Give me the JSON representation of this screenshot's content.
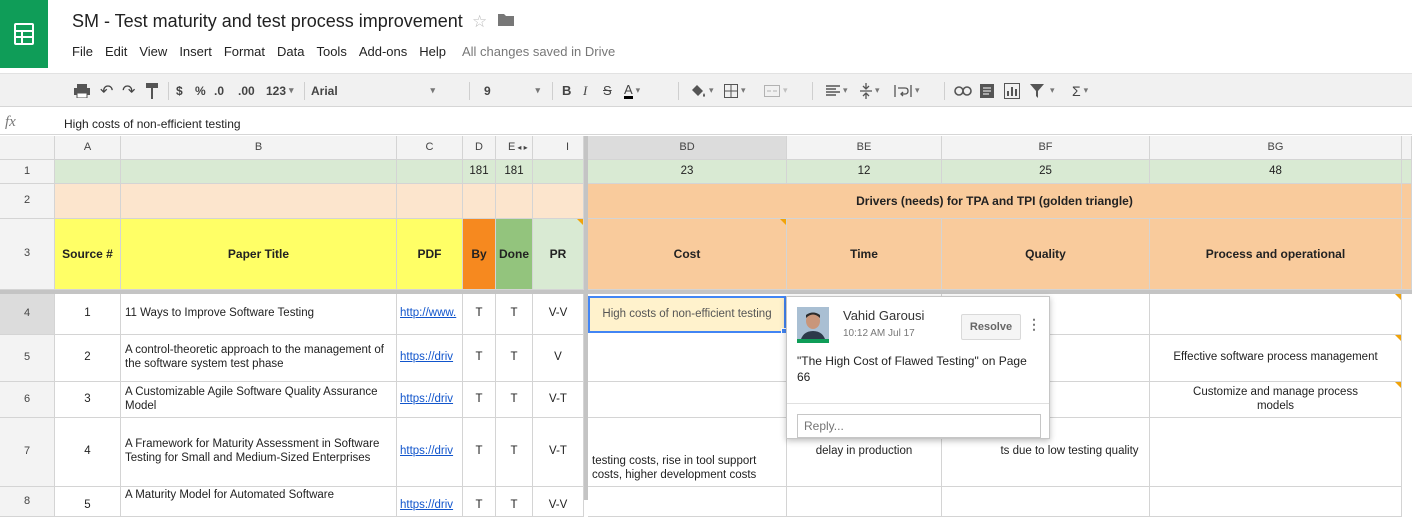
{
  "app": {
    "title": "SM - Test maturity and test process improvement",
    "save_status": "All changes saved in Drive",
    "colors": {
      "brand": "#0f9d58",
      "selection": "#4285f4"
    }
  },
  "menu": [
    "File",
    "Edit",
    "View",
    "Insert",
    "Format",
    "Data",
    "Tools",
    "Add-ons",
    "Help"
  ],
  "toolbar": {
    "currency": "$",
    "percent": "%",
    "dec_decrease": ".0",
    "dec_increase": ".00",
    "more_formats": "123",
    "font": "Arial",
    "font_size": "9",
    "bold": "B",
    "italic": "I",
    "strike": "S",
    "text_color": "A",
    "sum": "Σ"
  },
  "formula_bar": {
    "label": "fx",
    "value": "High costs of non-efficient testing"
  },
  "sheet": {
    "columns": [
      "A",
      "B",
      "C",
      "D",
      "E",
      "I",
      "BD",
      "BE",
      "BF",
      "BG"
    ],
    "col_arrows": "◂ ▸",
    "row_numbers": [
      "1",
      "2",
      "3",
      "4",
      "5",
      "6",
      "7",
      "8"
    ],
    "row1": {
      "D": "181",
      "E": "181",
      "BD": "23",
      "BE": "12",
      "BF": "25",
      "BG": "48"
    },
    "row2_banner": "Drivers (needs) for TPA and TPI (golden triangle)",
    "headers": {
      "A": "Source #",
      "B": "Paper Title",
      "C": "PDF",
      "D": "By",
      "E": "Done",
      "I": "PR",
      "BD": "Cost",
      "BE": "Time",
      "BF": "Quality",
      "BG": "Process and operational"
    },
    "rows": [
      {
        "A": "1",
        "B": "11 Ways to Improve Software Testing",
        "C": "http://www.",
        "D": "T",
        "E": "T",
        "I": "V-V",
        "BD": "High costs of non-efficient testing",
        "BE": "",
        "BF": "",
        "BG": ""
      },
      {
        "A": "2",
        "B": "A control-theoretic approach to the management of the software system test phase",
        "C": "https://driv",
        "D": "T",
        "E": "T",
        "I": "V",
        "BD": "",
        "BE": "",
        "BF": "",
        "BG": "Effective software process management"
      },
      {
        "A": "3",
        "B": "A Customizable Agile Software Quality Assurance Model",
        "C": "https://driv",
        "D": "T",
        "E": "T",
        "I": "V-T",
        "BD": "",
        "BE": "",
        "BF": "",
        "BG": "Customize and manage process models"
      },
      {
        "A": "4",
        "B": "A Framework for Maturity Assessment in Software Testing for Small and Medium-Sized Enterprises",
        "C": "https://driv",
        "D": "T",
        "E": "T",
        "I": "V-T",
        "BD": "testing costs, rise in tool support costs, higher development costs",
        "BE": "delay in production",
        "BF": "ts due to low testing quality",
        "BG": ""
      },
      {
        "A": "5",
        "B": "A Maturity Model for Automated Software",
        "C": "https://driv",
        "D": "T",
        "E": "T",
        "I": "V-V",
        "BD": "",
        "BE": "",
        "BF": "",
        "BG": ""
      }
    ]
  },
  "comment": {
    "author": "Vahid Garousi",
    "time": "10:12 AM Jul 17",
    "resolve_label": "Resolve",
    "text": "\"The High Cost of Flawed Testing\" on Page 66",
    "reply_placeholder": "Reply..."
  }
}
